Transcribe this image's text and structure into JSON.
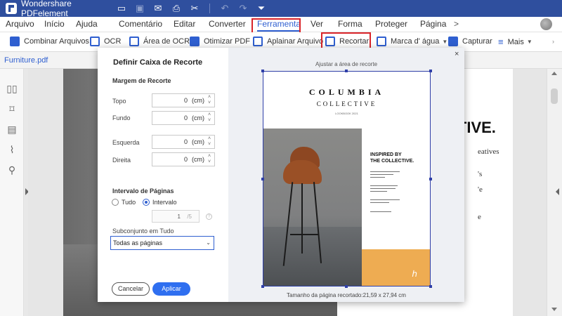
{
  "app": {
    "title": "Wondershare PDFelement"
  },
  "titlebar_icons": [
    "folder-icon",
    "save-icon",
    "mail-icon",
    "print-icon",
    "scissors-icon",
    "undo-icon",
    "redo-icon",
    "quick-access-icon"
  ],
  "menu": {
    "items": [
      "Arquivo",
      "Início",
      "Ajuda",
      "Comentário",
      "Editar",
      "Converter",
      "Ferramenta",
      "Ver",
      "Forma",
      "Proteger",
      "Página"
    ],
    "active": "Ferramenta",
    "more_glyph": ">"
  },
  "toolbar": {
    "combinar": "Combinar Arquivos",
    "ocr": "OCR",
    "area_ocr": "Área de OCR",
    "otimizar": "Otimizar PDF",
    "aplainar": "Aplainar Arquivo",
    "recortar": "Recortar",
    "marca": "Marca d' água",
    "capturar": "Capturar",
    "mais": "Mais"
  },
  "tab": {
    "file_name": "Furniture.pdf"
  },
  "document": {
    "big_text": "CTIVE.",
    "side_words": [
      "eatives",
      "'s",
      "'e",
      "e"
    ]
  },
  "dialog": {
    "title": "Definir Caixa de Recorte",
    "margin_section": "Margem de Recorte",
    "fields": [
      {
        "label": "Topo",
        "value": "0",
        "unit": "(cm)"
      },
      {
        "label": "Fundo",
        "value": "0",
        "unit": "(cm)"
      },
      {
        "label": "Esquerda",
        "value": "0",
        "unit": "(cm)"
      },
      {
        "label": "Direita",
        "value": "0",
        "unit": "(cm)"
      }
    ],
    "range_section": "Intervalo de Páginas",
    "radio_all": "Tudo",
    "radio_range": "Intervalo",
    "range_value": "1",
    "range_total": "/5",
    "subset_label": "Subconjunto em Tudo",
    "subset_value": "Todas as páginas",
    "cancel": "Cancelar",
    "apply": "Aplicar",
    "close": "×",
    "fit_label": "Ajustar a área de recorte",
    "size_label": "Tamanho da página recortado:21,59 x 27,94 cm"
  },
  "preview": {
    "brand": "COLUMBIA",
    "sub": "COLLECTIVE",
    "small": "LOOKBOOK 2021",
    "heading_1": "INSPIRED BY",
    "heading_2": "THE COLLECTIVE."
  },
  "colors": {
    "titlebar": "#2f4f9e",
    "accent": "#2f5fd0",
    "highlight": "#d9242a",
    "apply": "#2f6ff0",
    "orange": "#eeac52"
  }
}
